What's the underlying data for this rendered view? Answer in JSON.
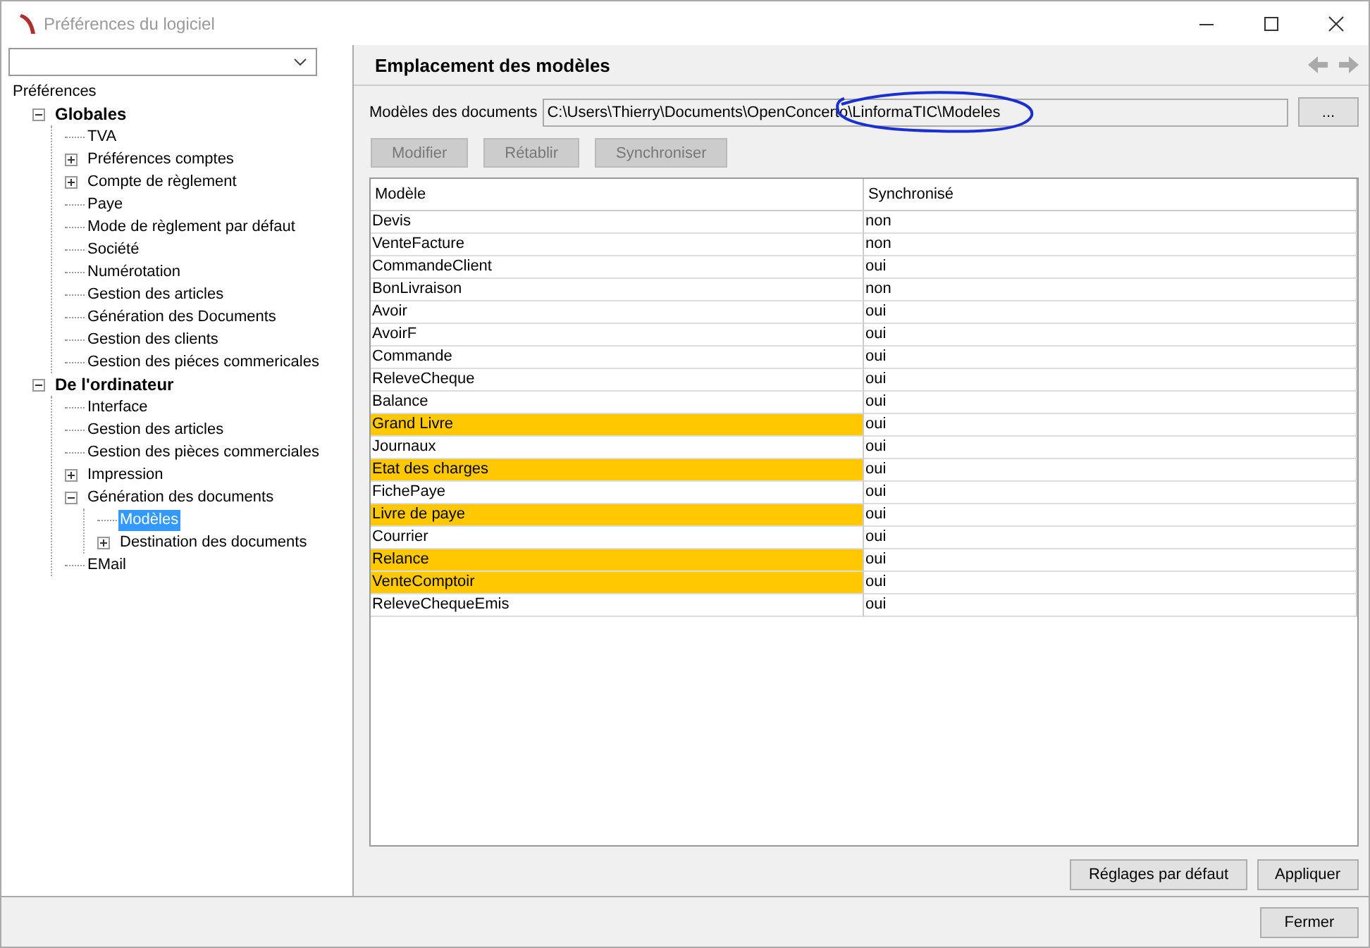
{
  "window": {
    "title": "Préférences du logiciel"
  },
  "sidebar": {
    "tree": {
      "label": "Préférences",
      "kind": "root",
      "selected": false,
      "children": [
        {
          "label": "Globales",
          "kind": "group",
          "expanded": true,
          "selected": false,
          "children": [
            {
              "label": "TVA",
              "kind": "page",
              "selected": false
            },
            {
              "label": "Préférences comptes",
              "kind": "page",
              "expanded": false,
              "selected": false
            },
            {
              "label": "Compte de règlement",
              "kind": "page",
              "expanded": false,
              "selected": false
            },
            {
              "label": "Paye",
              "kind": "page",
              "selected": false
            },
            {
              "label": "Mode de règlement par défaut",
              "kind": "page",
              "selected": false
            },
            {
              "label": "Société",
              "kind": "page",
              "selected": false
            },
            {
              "label": "Numérotation",
              "kind": "page",
              "selected": false
            },
            {
              "label": "Gestion des articles",
              "kind": "page",
              "selected": false
            },
            {
              "label": "Génération des Documents",
              "kind": "page",
              "selected": false
            },
            {
              "label": "Gestion des clients",
              "kind": "page",
              "selected": false
            },
            {
              "label": "Gestion des piéces commericales",
              "kind": "page",
              "selected": false
            }
          ]
        },
        {
          "label": "De l'ordinateur",
          "kind": "group",
          "expanded": true,
          "selected": false,
          "children": [
            {
              "label": "Interface",
              "kind": "page",
              "selected": false
            },
            {
              "label": "Gestion des articles",
              "kind": "page",
              "selected": false
            },
            {
              "label": "Gestion des pièces commerciales",
              "kind": "page",
              "selected": false
            },
            {
              "label": "Impression",
              "kind": "page",
              "expanded": false,
              "selected": false
            },
            {
              "label": "Génération des documents",
              "kind": "page",
              "expanded": true,
              "selected": false,
              "children": [
                {
                  "label": "Modèles",
                  "kind": "page",
                  "selected": true
                },
                {
                  "label": "Destination des documents",
                  "kind": "page",
                  "expanded": false,
                  "selected": false
                }
              ]
            },
            {
              "label": "EMail",
              "kind": "page",
              "selected": false
            }
          ]
        }
      ]
    }
  },
  "panel": {
    "title": "Emplacement des modèles",
    "path_field": {
      "label": "Modèles des documents",
      "value": "C:\\Users\\Thierry\\Documents\\OpenConcerto\\LinformaTIC\\Modeles",
      "browse": "..."
    },
    "actions": [
      {
        "label": "Modifier",
        "disabled": true
      },
      {
        "label": "Rétablir",
        "disabled": true
      },
      {
        "label": "Synchroniser",
        "disabled": true
      }
    ],
    "table": {
      "columns": [
        "Modèle",
        "Synchronisé"
      ],
      "rows": [
        {
          "model": "Devis",
          "synced": "non",
          "highlighted": false
        },
        {
          "model": "VenteFacture",
          "synced": "non",
          "highlighted": false
        },
        {
          "model": "CommandeClient",
          "synced": "oui",
          "highlighted": false
        },
        {
          "model": "BonLivraison",
          "synced": "non",
          "highlighted": false
        },
        {
          "model": "Avoir",
          "synced": "oui",
          "highlighted": false
        },
        {
          "model": "AvoirF",
          "synced": "oui",
          "highlighted": false
        },
        {
          "model": "Commande",
          "synced": "oui",
          "highlighted": false
        },
        {
          "model": "ReleveCheque",
          "synced": "oui",
          "highlighted": false
        },
        {
          "model": "Balance",
          "synced": "oui",
          "highlighted": false
        },
        {
          "model": "Grand Livre",
          "synced": "oui",
          "highlighted": true
        },
        {
          "model": "Journaux",
          "synced": "oui",
          "highlighted": false
        },
        {
          "model": "Etat des charges",
          "synced": "oui",
          "highlighted": true
        },
        {
          "model": "FichePaye",
          "synced": "oui",
          "highlighted": false
        },
        {
          "model": "Livre de paye",
          "synced": "oui",
          "highlighted": true
        },
        {
          "model": "Courrier",
          "synced": "oui",
          "highlighted": false
        },
        {
          "model": "Relance",
          "synced": "oui",
          "highlighted": true
        },
        {
          "model": "VenteComptoir",
          "synced": "oui",
          "highlighted": true
        },
        {
          "model": "ReleveChequeEmis",
          "synced": "oui",
          "highlighted": false
        }
      ]
    },
    "buttons": [
      {
        "label": "Réglages par défaut",
        "disabled": false
      },
      {
        "label": "Appliquer",
        "disabled": false
      }
    ]
  },
  "footer": {
    "buttons": [
      {
        "label": "Fermer",
        "disabled": false
      }
    ]
  }
}
